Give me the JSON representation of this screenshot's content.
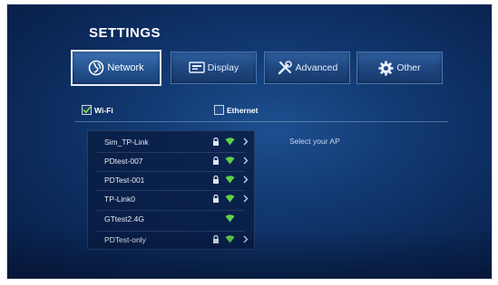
{
  "header": {
    "title": "SETTINGS"
  },
  "tabs": [
    {
      "label": "Network",
      "icon": "globe-icon",
      "active": true
    },
    {
      "label": "Display",
      "icon": "display-icon",
      "active": false
    },
    {
      "label": "Advanced",
      "icon": "tools-icon",
      "active": false
    },
    {
      "label": "Other",
      "icon": "gear-icon",
      "active": false
    }
  ],
  "connection": {
    "wifi": {
      "label": "Wi-Fi",
      "checked": true
    },
    "ethernet": {
      "label": "Ethernet",
      "checked": false
    }
  },
  "ap_list": [
    {
      "name": "Sim_TP-Link",
      "locked": true,
      "chevron": true
    },
    {
      "name": "PDtest-007",
      "locked": true,
      "chevron": true
    },
    {
      "name": "PDTest-001",
      "locked": true,
      "chevron": true
    },
    {
      "name": "TP-Link0",
      "locked": true,
      "chevron": true
    },
    {
      "name": "GTtest2.4G",
      "locked": false,
      "chevron": false
    },
    {
      "name": "PDTest-only",
      "locked": true,
      "chevron": true
    }
  ],
  "detail": {
    "hint": "Select your AP"
  },
  "colors": {
    "accent": "#2a5a98",
    "check": "#7ed957",
    "signal": "#5fd14a"
  }
}
